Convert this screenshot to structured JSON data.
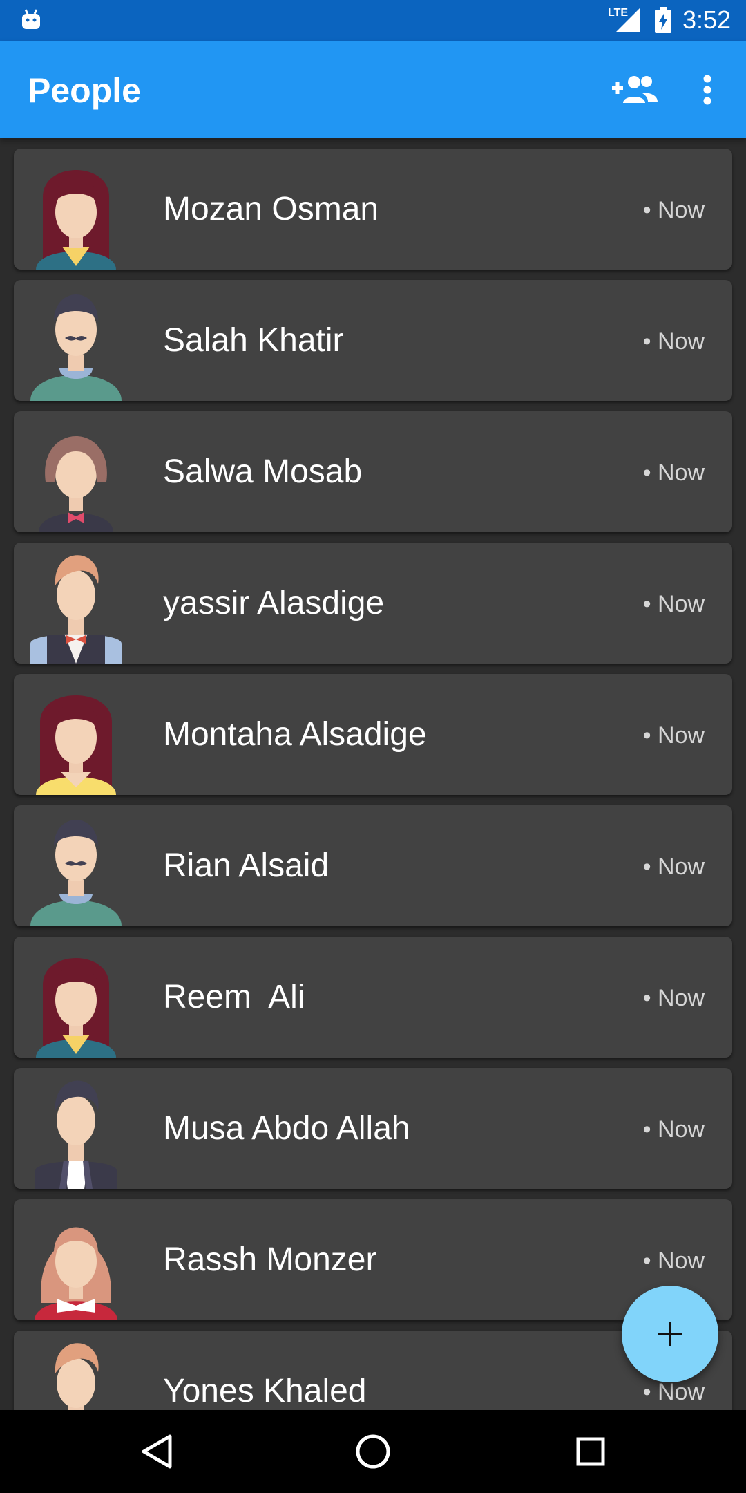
{
  "status_bar": {
    "network": "LTE",
    "time": "3:52"
  },
  "app_bar": {
    "title": "People",
    "icons": [
      "add-people-icon",
      "more-vert-icon"
    ],
    "color": "#2196f3"
  },
  "people": [
    {
      "name": "Mozan Osman",
      "time": "• Now",
      "avatar": "woman-dark-red-hair"
    },
    {
      "name": "Salah Khatir",
      "time": "• Now",
      "avatar": "man-mustache"
    },
    {
      "name": "Salwa Mosab",
      "time": "• Now",
      "avatar": "woman-bob-bowtie"
    },
    {
      "name": "yassir Alasdige",
      "time": "• Now",
      "avatar": "man-vest-bowtie"
    },
    {
      "name": "Montaha Alsadige",
      "time": "• Now",
      "avatar": "woman-dark-red-hair-yellow"
    },
    {
      "name": "Rian Alsaid",
      "time": "• Now",
      "avatar": "man-mustache"
    },
    {
      "name": "Reem  Ali",
      "time": "• Now",
      "avatar": "woman-dark-red-hair"
    },
    {
      "name": "Musa Abdo Allah",
      "time": "• Now",
      "avatar": "man-suit"
    },
    {
      "name": "Rassh Monzer",
      "time": "• Now",
      "avatar": "woman-blonde-red"
    },
    {
      "name": "Yones Khaled",
      "time": "• Now",
      "avatar": "man-vest-bowtie"
    }
  ],
  "fab": {
    "icon": "plus-icon",
    "color": "#81d4fa"
  },
  "nav_bar": {
    "icons": [
      "back-icon",
      "home-icon",
      "recents-icon"
    ]
  }
}
